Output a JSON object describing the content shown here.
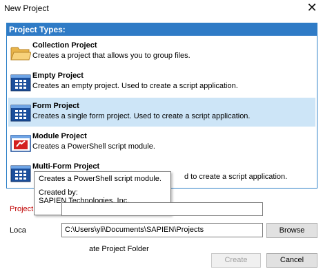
{
  "window": {
    "title": "New Project",
    "close_glyph": "✕"
  },
  "panel": {
    "header": "Project Types:",
    "items": [
      {
        "name": "Collection Project",
        "description": "Creates a project that allows you to group files.",
        "icon": "folder-icon",
        "selected": false
      },
      {
        "name": "Empty Project",
        "description": "Creates an empty project. Used to create a script application.",
        "icon": "grid-window-icon",
        "selected": false
      },
      {
        "name": "Form Project",
        "description": "Creates a single form project. Used to create a script application.",
        "icon": "grid-window-icon",
        "selected": true
      },
      {
        "name": "Module Project",
        "description": "Creates a PowerShell script module.",
        "icon": "module-icon",
        "selected": false
      },
      {
        "name": "Multi-Form Project",
        "description": "d to create a script application.",
        "icon": "grid-window-icon",
        "selected": false
      }
    ]
  },
  "tooltip": {
    "line1": "Creates a PowerShell script module.",
    "line2": "Created by:",
    "line3": "SAPIEN Technologies, Inc."
  },
  "form": {
    "project_label": "Project",
    "project_value": "",
    "location_label": "Loca",
    "location_value": "C:\\Users\\yli\\Documents\\SAPIEN\\Projects",
    "browse_label": "Browse",
    "folder_option_text": "ate Project Folder"
  },
  "buttons": {
    "create": "Create",
    "cancel": "Cancel"
  },
  "colors": {
    "accent": "#2f7bc6",
    "selected": "#cde5f7",
    "required_label": "#c00000"
  }
}
